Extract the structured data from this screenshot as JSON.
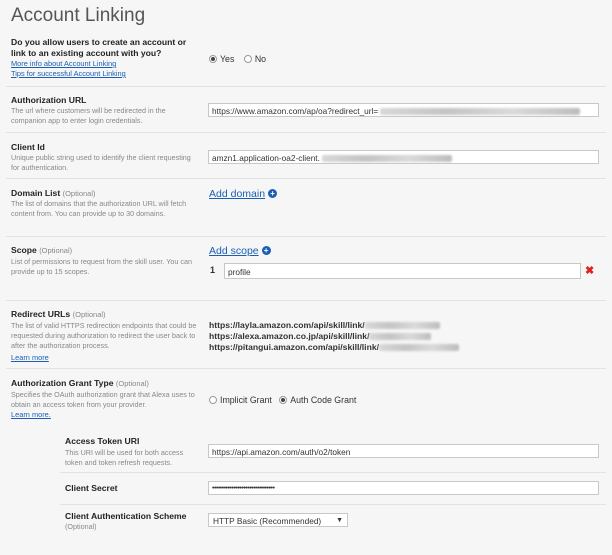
{
  "page_title": "Account Linking",
  "allow_linking": {
    "label": "Do you allow users to create an account or link to an existing account with you?",
    "link_more": "More info about Account Linking",
    "link_tips": "Tips for successful Account Linking",
    "yes": "Yes",
    "no": "No",
    "selected": "Yes"
  },
  "auth_url": {
    "label": "Authorization URL",
    "desc": "The url where customers will be redirected in the companion app to enter login credentials.",
    "value": "https://www.amazon.com/ap/oa?redirect_url="
  },
  "client_id": {
    "label": "Client Id",
    "desc": "Unique public string used to identify the client requesting for authentication.",
    "value": "amzn1.application-oa2-client."
  },
  "domain_list": {
    "label": "Domain List",
    "optional": "(Optional)",
    "desc": "The list of domains that the authorization URL will fetch content from. You can provide up to 30 domains.",
    "add": "Add domain"
  },
  "scope": {
    "label": "Scope",
    "optional": "(Optional)",
    "desc": "List of permissions to request from the skill user. You can provide up to 15 scopes.",
    "add": "Add scope",
    "items": [
      {
        "index": "1",
        "value": "profile"
      }
    ]
  },
  "redirect_urls": {
    "label": "Redirect URLs",
    "optional": "(Optional)",
    "desc": "The list of valid HTTPS redirection endpoints that could be requested during authorization to redirect the user back to after the authorization process.",
    "learn": "Learn more",
    "urls": [
      "https://layla.amazon.com/api/skill/link/",
      "https://alexa.amazon.co.jp/api/skill/link/",
      "https://pitangui.amazon.com/api/skill/link/"
    ]
  },
  "grant_type": {
    "label": "Authorization Grant Type",
    "optional": "(Optional)",
    "desc": "Specifies the OAuth authorization grant that Alexa uses to obtain an access token from your provider.",
    "learn": "Learn more.",
    "implicit": "Implicit Grant",
    "auth_code": "Auth Code Grant",
    "selected": "Auth Code Grant"
  },
  "access_token": {
    "label": "Access Token URI",
    "desc": "This URI will be used for both access token and token refresh requests.",
    "value": "https://api.amazon.com/auth/o2/token"
  },
  "client_secret": {
    "label": "Client Secret",
    "value": "••••••••••••••••••••••••••••••••"
  },
  "client_auth": {
    "label": "Client Authentication Scheme",
    "optional": "(Optional)",
    "value": "HTTP Basic (Recommended)"
  },
  "colors": {
    "link": "#1a5fb4",
    "delete": "#dd2222"
  }
}
